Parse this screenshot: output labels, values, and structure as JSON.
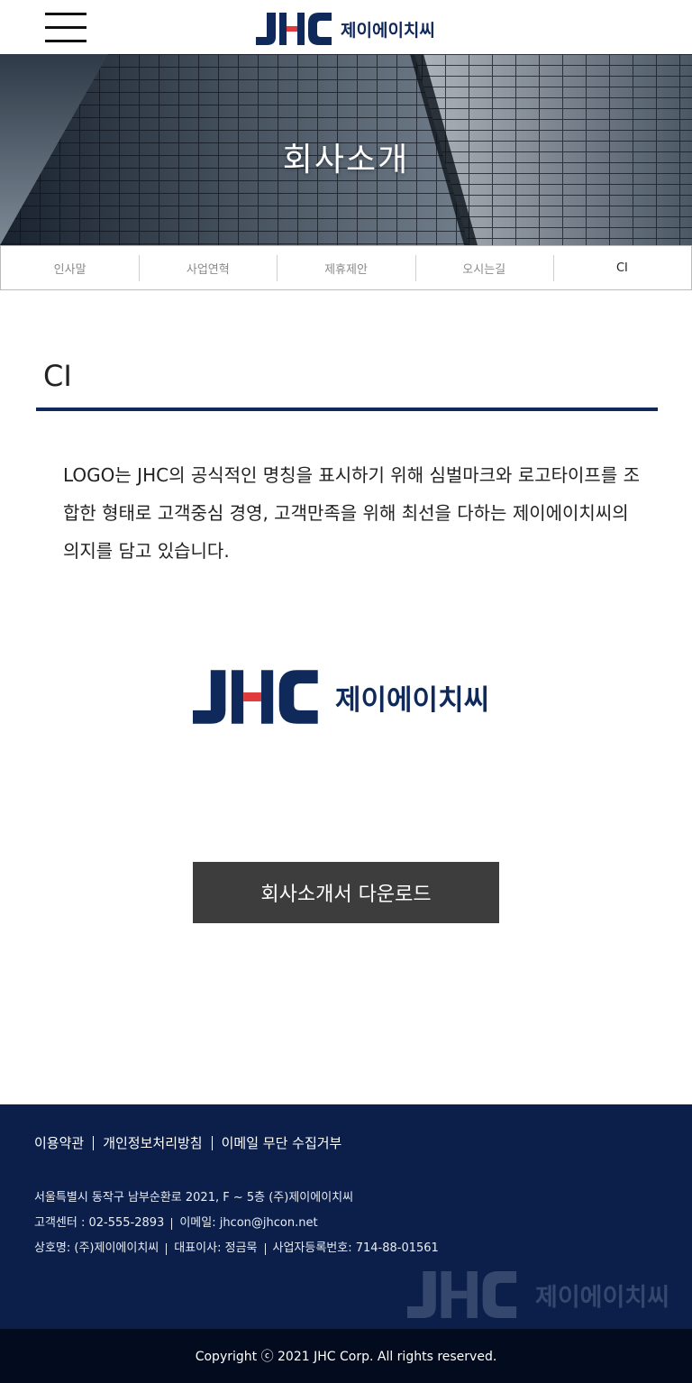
{
  "header": {
    "brand_name": "제이에이치씨",
    "brand_letters": "JHC"
  },
  "hero": {
    "title": "회사소개"
  },
  "tabs": [
    {
      "label": "인사말"
    },
    {
      "label": "사업연혁"
    },
    {
      "label": "제휴제안"
    },
    {
      "label": "오시는길"
    },
    {
      "label": "CI",
      "active": true
    }
  ],
  "section": {
    "title": "CI",
    "description": "LOGO는 JHC의 공식적인 명칭을 표시하기 위해 심벌마크와 로고타이프를 조합한 형태로 고객중심 경영, 고객만족을 위해 최선을 다하는 제이에이치씨의 의지를 담고 있습니다."
  },
  "download_button": {
    "label": "회사소개서 다운로드"
  },
  "footer": {
    "links": [
      "이용약관",
      "개인정보처리방침",
      "이메일 무단 수집거부"
    ],
    "address": "서울특별시 동작구 남부순환로 2021, F ~ 5층 (주)제이에이치씨",
    "customer_center": "고객센터 : 02-555-2893",
    "email": "이메일: jhcon@jhcon.net",
    "company_name": "상호명: (주)제이에이치씨",
    "ceo": "대표이사: 정금묵",
    "business_number": "사업자등록번호: 714-88-01561"
  },
  "copyright": "Copyright ⓒ 2021 JHC Corp. All rights reserved.",
  "colors": {
    "brand_navy": "#0f2a5a",
    "brand_red": "#e03a3a",
    "footer_bg": "#0b1f4a",
    "copyright_bg": "#030b1f",
    "button_bg": "#3d3d3d"
  }
}
